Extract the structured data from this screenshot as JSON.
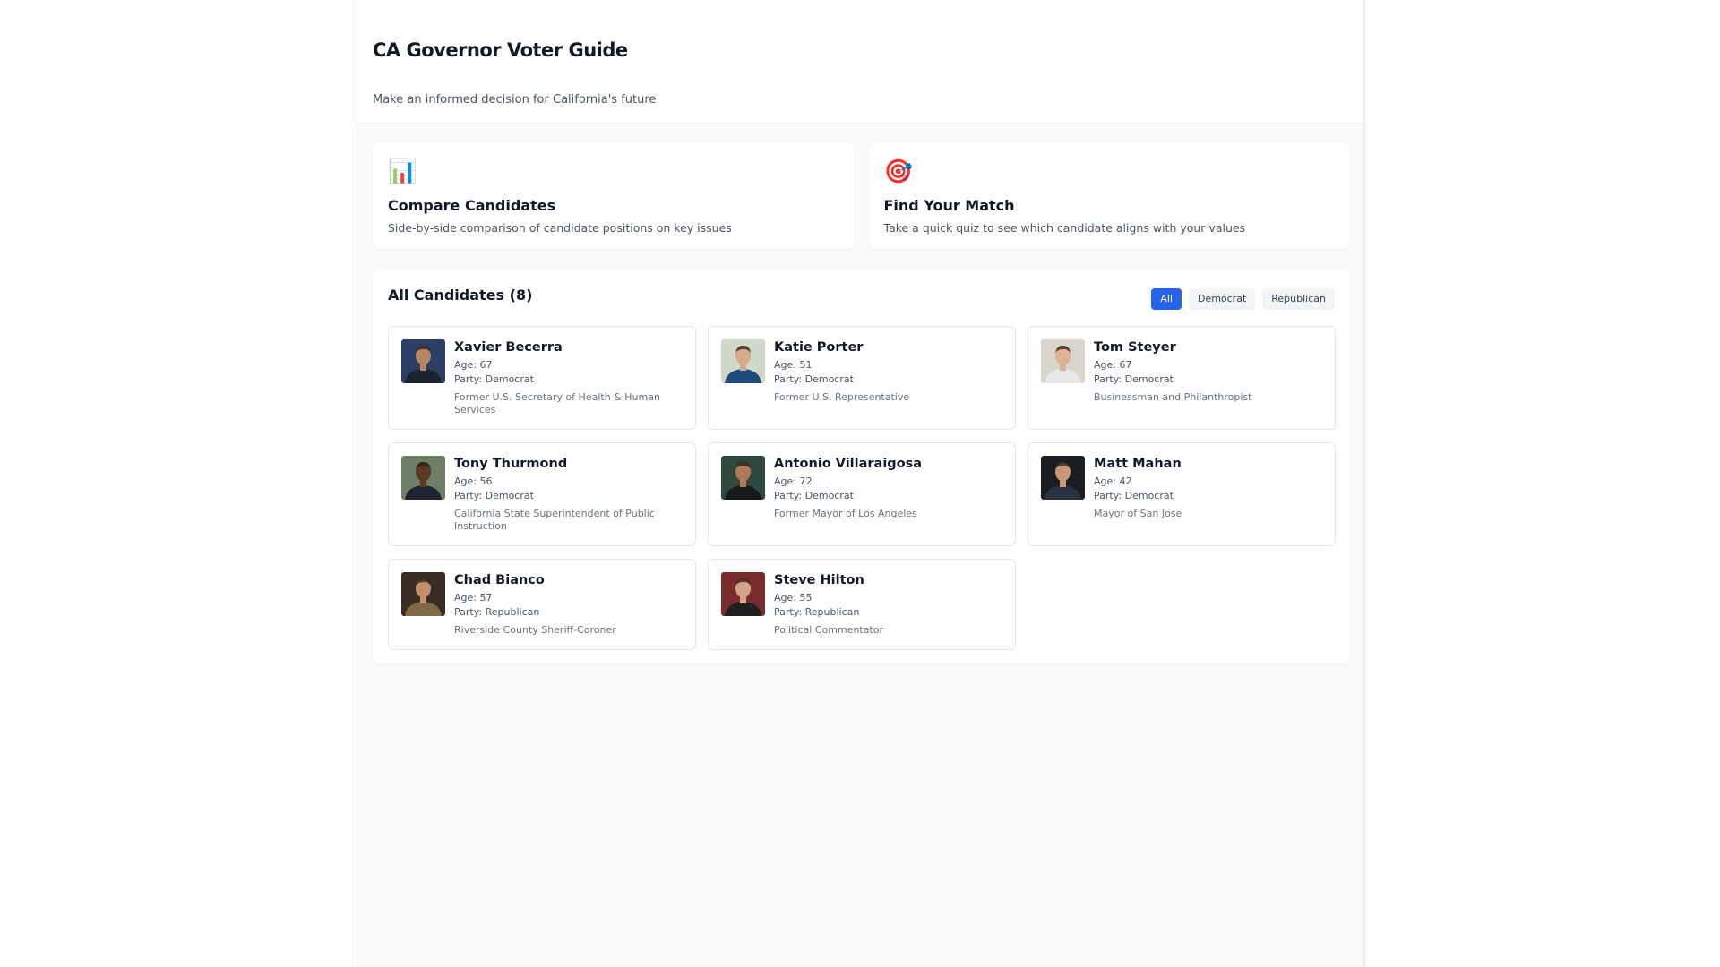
{
  "header": {
    "title": "CA Governor Voter Guide",
    "subtitle": "Make an informed decision for California's future"
  },
  "features": [
    {
      "icon": "bar-chart-icon",
      "glyph": "📊",
      "title": "Compare Candidates",
      "description": "Side-by-side comparison of candidate positions on key issues"
    },
    {
      "icon": "target-icon",
      "glyph": "🎯",
      "title": "Find Your Match",
      "description": "Take a quick quiz to see which candidate aligns with your values"
    }
  ],
  "candidates_panel": {
    "title": "All Candidates (8)",
    "filters": [
      {
        "label": "All",
        "active": true
      },
      {
        "label": "Democrat",
        "active": false
      },
      {
        "label": "Republican",
        "active": false
      }
    ]
  },
  "candidates": [
    {
      "name": "Xavier Becerra",
      "age": "Age: 67",
      "party": "Party: Democrat",
      "role": "Former U.S. Secretary of Health & Human Services",
      "photo_bg": "#2b3f66",
      "photo_skin": "#b8865f",
      "photo_suit": "#1b2230"
    },
    {
      "name": "Katie Porter",
      "age": "Age: 51",
      "party": "Party: Democrat",
      "role": "Former U.S. Representative",
      "photo_bg": "#cfd8c9",
      "photo_skin": "#d6a98a",
      "photo_suit": "#1f4b7a"
    },
    {
      "name": "Tom Steyer",
      "age": "Age: 67",
      "party": "Party: Democrat",
      "role": "Businessman and Philanthropist",
      "photo_bg": "#d9d4cc",
      "photo_skin": "#e0b294",
      "photo_suit": "#e8e8e8"
    },
    {
      "name": "Tony Thurmond",
      "age": "Age: 56",
      "party": "Party: Democrat",
      "role": "California State Superintendent of Public Instruction",
      "photo_bg": "#6f7f66",
      "photo_skin": "#5a3a26",
      "photo_suit": "#1e2433"
    },
    {
      "name": "Antonio Villaraigosa",
      "age": "Age: 72",
      "party": "Party: Democrat",
      "role": "Former Mayor of Los Angeles",
      "photo_bg": "#2f4a3c",
      "photo_skin": "#b07a58",
      "photo_suit": "#15181d"
    },
    {
      "name": "Matt Mahan",
      "age": "Age: 42",
      "party": "Party: Democrat",
      "role": "Mayor of San Jose",
      "photo_bg": "#1a1d22",
      "photo_skin": "#c99776",
      "photo_suit": "#2a3140"
    },
    {
      "name": "Chad Bianco",
      "age": "Age: 57",
      "party": "Party: Republican",
      "role": "Riverside County Sheriff-Coroner",
      "photo_bg": "#3a2e24",
      "photo_skin": "#c58f6c",
      "photo_suit": "#7d6a44"
    },
    {
      "name": "Steve Hilton",
      "age": "Age: 55",
      "party": "Party: Republican",
      "role": "Political Commentator",
      "photo_bg": "#7a2c2c",
      "photo_skin": "#d2a488",
      "photo_suit": "#202020"
    }
  ]
}
